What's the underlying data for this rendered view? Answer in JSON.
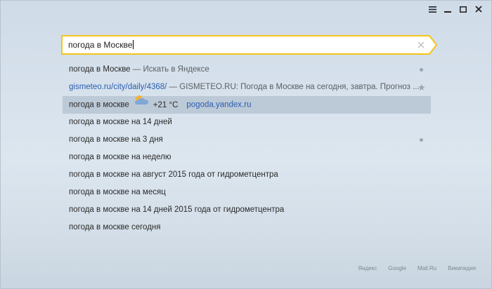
{
  "window": {
    "controls": [
      "menu-icon",
      "minimize-icon",
      "maximize-icon",
      "close-icon"
    ]
  },
  "omnibox": {
    "value": "погода в Москве",
    "accent_color": "#f5c518"
  },
  "suggestions": {
    "row1": {
      "query": "погода в Москве",
      "hint": " — Искать в Яндексе"
    },
    "row2": {
      "url": "gismeteo.ru/city/daily/4368/",
      "title": " — GISMETEO.RU: Погода в Москве на сегодня, завтра. Прогноз ..."
    },
    "row3": {
      "query": "погода в москве",
      "temp": "+21 °C",
      "source": "pogoda.yandex.ru"
    },
    "items": [
      "погода в москве на 14 дней",
      "погода в москве на 3 дня",
      "погода в москве на неделю",
      "погода в москве на август 2015 года от гидрометцентра",
      "погода в москве на месяц",
      "погода в москве на 14 дней 2015 года от гидрометцентра",
      "погода в москве сегодня"
    ]
  },
  "footer": {
    "links": [
      "Яндекс",
      "Google",
      "Mail.Ru",
      "Википедия"
    ]
  }
}
